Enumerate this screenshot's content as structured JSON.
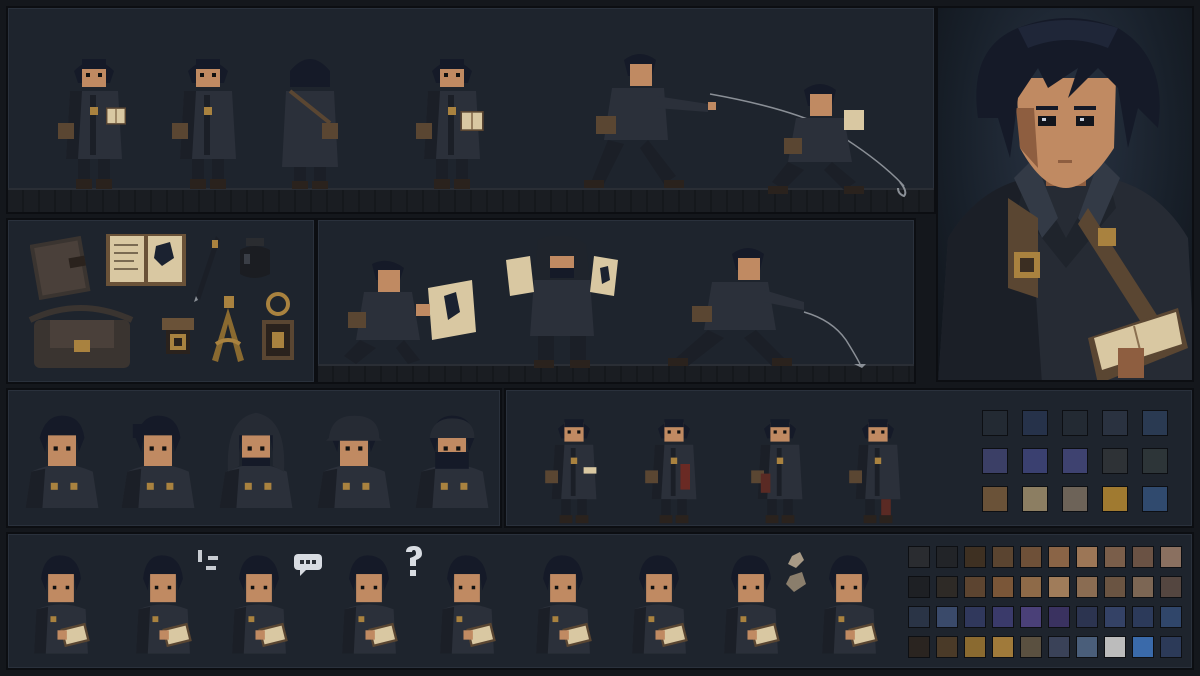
{
  "sheet": {
    "character": "hooded-scribe",
    "palette_colors": {
      "coat": "#2b303a",
      "coat_shadow": "#1b1f27",
      "hair": "#151a28",
      "skin": "#c08a62",
      "skin_shadow": "#8e5e40",
      "leather": "#5a4632",
      "brass": "#a9823f",
      "paper": "#d9c8a2",
      "ink": "#1b2230",
      "boot": "#2a221d",
      "rope": "#8a8f96"
    }
  },
  "rows": {
    "walk_poses": [
      "front-book",
      "side-bag",
      "back",
      "three-quarter-reading",
      "lasso-throw",
      "crouch-pull"
    ],
    "items": [
      "journal",
      "open-book",
      "quill",
      "ink-pot",
      "satchel",
      "brass-buckle",
      "compass-tool",
      "brass-lantern-charm"
    ],
    "actions": [
      "crouch-inspect-map",
      "hooded-show-notes",
      "lunge-hook"
    ],
    "head_variants": [
      "tousled",
      "ponytail",
      "hood",
      "cap",
      "masked"
    ],
    "damage_poses": [
      "bandaged",
      "bloodied",
      "torn-coat",
      "hurt-crouch"
    ],
    "emotes": [
      "neutral",
      "alert",
      "speech",
      "question",
      "reading",
      "focused",
      "calm",
      "frustrated",
      "surprised"
    ]
  },
  "palette_small": [
    [
      "#232a33",
      "#26324a",
      "#232a33",
      "#2a3240",
      "#2a3a52"
    ],
    [
      "#3b3f66",
      "#3a4070",
      "#3e4270",
      "#2e3236",
      "#2d3538"
    ],
    [
      "#6a5238",
      "#8c7e62",
      "#6d6358",
      "#a07a30",
      "#304a6e"
    ]
  ],
  "palette_large": [
    [
      "#2a2c30",
      "#222428",
      "#3e3022",
      "#5a4430",
      "#6e5038",
      "#8a6446",
      "#9c7656",
      "#7a5e4a",
      "#6a5244",
      "#8a7060"
    ],
    [
      "#1e2024",
      "#2e2a26",
      "#5c4430",
      "#7a5638",
      "#8e6a48",
      "#a07c5a",
      "#8a6c52",
      "#6a5442",
      "#7c6654",
      "#544640"
    ],
    [
      "#2a3446",
      "#3a4a6a",
      "#30385c",
      "#3a3a6a",
      "#4a4078",
      "#3a3260",
      "#2c3450",
      "#344266",
      "#2c3a5a",
      "#30466a"
    ],
    [
      "#2a2420",
      "#4a3a28",
      "#8a6a30",
      "#a07a3a",
      "#5a5040",
      "#3a4258",
      "#4a5e7a",
      "#bcbcbc",
      "#3a6aaa",
      "#2c3a58"
    ]
  ]
}
